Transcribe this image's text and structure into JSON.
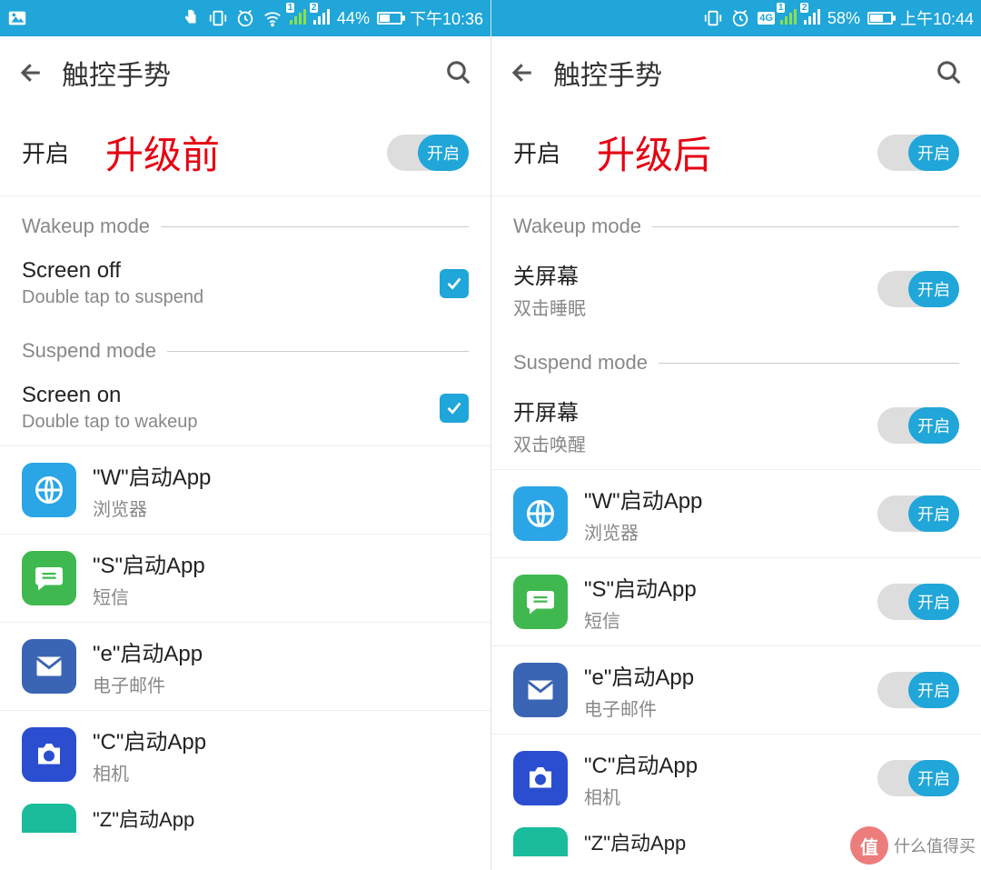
{
  "left": {
    "status": {
      "battery_pct": "44%",
      "time": "下午10:36",
      "sim1": "1",
      "sim2": "2",
      "battery_fill": 44
    },
    "appbar": {
      "title": "触控手势"
    },
    "annotation": "升级前",
    "master": {
      "label": "开启",
      "toggle_label": "开启"
    },
    "sections": {
      "wakeup": "Wakeup mode",
      "suspend": "Suspend mode"
    },
    "wakeup_item": {
      "title": "Screen off",
      "sub": "Double tap to suspend"
    },
    "suspend_item": {
      "title": "Screen on",
      "sub": "Double tap to wakeup"
    },
    "apps": [
      {
        "title": "\"W\"启动App",
        "sub": "浏览器"
      },
      {
        "title": "\"S\"启动App",
        "sub": "短信"
      },
      {
        "title": "\"e\"启动App",
        "sub": "电子邮件"
      },
      {
        "title": "\"C\"启动App",
        "sub": "相机"
      }
    ],
    "partial": {
      "title": "\"Z\"启动App"
    }
  },
  "right": {
    "status": {
      "battery_pct": "58%",
      "time": "上午10:44",
      "sim1": "1",
      "sim2": "2",
      "battery_fill": 58,
      "net": "4G"
    },
    "appbar": {
      "title": "触控手势"
    },
    "annotation": "升级后",
    "master": {
      "label": "开启",
      "toggle_label": "开启"
    },
    "sections": {
      "wakeup": "Wakeup mode",
      "suspend": "Suspend mode"
    },
    "wakeup_item": {
      "title": "关屏幕",
      "sub": "双击睡眠",
      "toggle": "开启"
    },
    "suspend_item": {
      "title": "开屏幕",
      "sub": "双击唤醒",
      "toggle": "开启"
    },
    "apps": [
      {
        "title": "\"W\"启动App",
        "sub": "浏览器",
        "toggle": "开启"
      },
      {
        "title": "\"S\"启动App",
        "sub": "短信",
        "toggle": "开启"
      },
      {
        "title": "\"e\"启动App",
        "sub": "电子邮件",
        "toggle": "开启"
      },
      {
        "title": "\"C\"启动App",
        "sub": "相机",
        "toggle": "开启"
      }
    ],
    "partial": {
      "title": "\"Z\"启动App"
    }
  },
  "watermark": {
    "char": "值",
    "text": "什么值得买"
  }
}
